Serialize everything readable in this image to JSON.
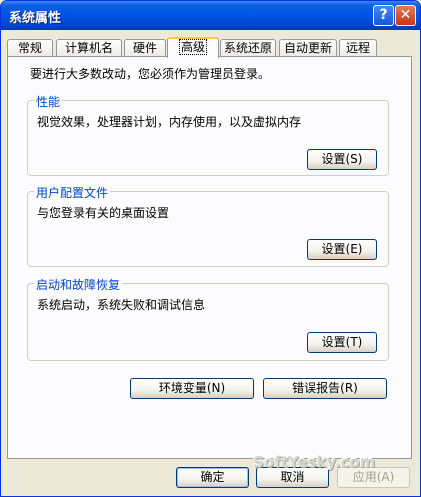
{
  "window": {
    "title": "系统属性",
    "help_glyph": "?",
    "close_glyph": "✕"
  },
  "tabs": [
    {
      "label": "常规"
    },
    {
      "label": "计算机名"
    },
    {
      "label": "硬件"
    },
    {
      "label": "高级"
    },
    {
      "label": "系统还原"
    },
    {
      "label": "自动更新"
    },
    {
      "label": "远程"
    }
  ],
  "advanced": {
    "admin_note": "要进行大多数改动，您必须作为管理员登录。",
    "performance": {
      "title": "性能",
      "description": "视觉效果，处理器计划，内存使用，以及虚拟内存",
      "button": "设置(S)"
    },
    "user_profiles": {
      "title": "用户配置文件",
      "description": "与您登录有关的桌面设置",
      "button": "设置(E)"
    },
    "startup_recovery": {
      "title": "启动和故障恢复",
      "description": "系统启动，系统失败和调试信息",
      "button": "设置(T)"
    },
    "env_vars_button": "环境变量(N)",
    "error_report_button": "错误报告(R)"
  },
  "footer": {
    "ok": "确定",
    "cancel": "取消",
    "apply": "应用(A)"
  },
  "watermark": "SoftYesky.com",
  "colors": {
    "title_bar": "#0054e3",
    "group_title": "#0046d5",
    "active_tab_accent": "#ffc83c",
    "dialog_bg": "#ece9d8"
  }
}
